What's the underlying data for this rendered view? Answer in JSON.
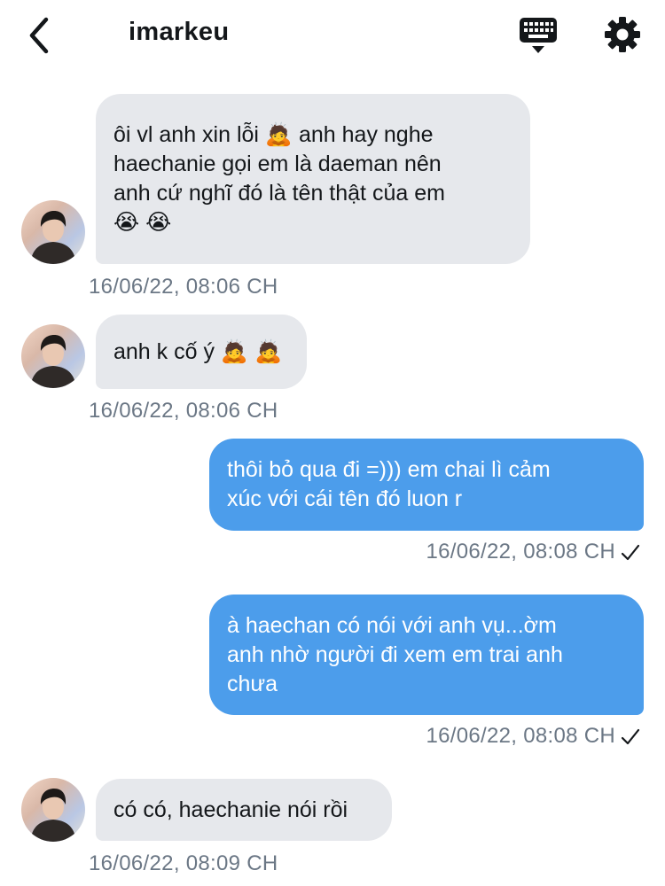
{
  "header": {
    "title": "imarkeu",
    "back_icon": "chevron-left-icon",
    "keyboard_icon": "keyboard-icon",
    "settings_icon": "gear-icon"
  },
  "messages": [
    {
      "direction": "incoming",
      "text": "ôi vl anh xin lỗi 🙇 anh hay nghe\nhaechanie gọi em là daeman nên\nanh cứ nghĩ đó là tên thật của em\n😭 😭",
      "timestamp": "16/06/22, 08:06 CH"
    },
    {
      "direction": "incoming",
      "text": "anh k cố ý 🙇 🙇",
      "timestamp": "16/06/22, 08:06 CH"
    },
    {
      "direction": "outgoing",
      "text": "thôi bỏ qua đi =))) em chai lì cảm\nxúc với cái tên đó luon r",
      "timestamp": "16/06/22, 08:08 CH",
      "status_icon": "checkmark-icon"
    },
    {
      "direction": "outgoing",
      "text": "à haechan có nói với anh vụ...ờm\nanh nhờ người đi xem em trai anh\nchưa",
      "timestamp": "16/06/22, 08:08 CH",
      "status_icon": "checkmark-icon"
    },
    {
      "direction": "incoming",
      "text": "có có, haechanie nói rồi",
      "timestamp": "16/06/22, 08:09 CH"
    }
  ],
  "colors": {
    "incoming_bubble": "#e6e8ec",
    "outgoing_bubble": "#4c9deb",
    "timestamp": "#6b7785"
  }
}
